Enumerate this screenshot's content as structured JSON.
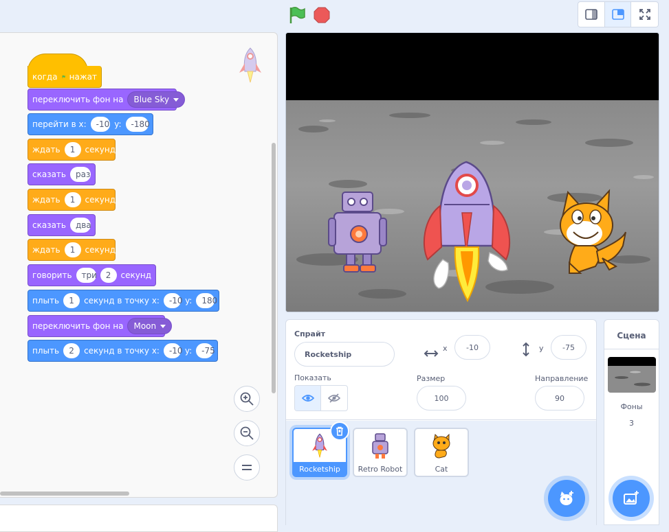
{
  "colors": {
    "events": "#ffbf00",
    "looks": "#9966ff",
    "motion": "#4c97ff",
    "control": "#ffab19",
    "accent": "#4c97ff"
  },
  "toolbar": {
    "green_flag": "green-flag-icon",
    "stop": "stop-icon",
    "layout_small": "small-stage-icon",
    "layout_normal": "normal-stage-icon",
    "fullscreen": "fullscreen-icon"
  },
  "script": {
    "hat": {
      "text1": "когда",
      "text2": "нажат"
    },
    "b1": {
      "text": "переключить фон на",
      "backdrop": "Blue Sky"
    },
    "b2": {
      "text": "перейти в x:",
      "x": "-10",
      "ylabel": "y:",
      "y": "-180"
    },
    "b3": {
      "text": "ждать",
      "secs": "1",
      "unit": "секунд"
    },
    "b4": {
      "text": "сказать",
      "msg": "раз"
    },
    "b5": {
      "text": "ждать",
      "secs": "1",
      "unit": "секунд"
    },
    "b6": {
      "text": "сказать",
      "msg": "два"
    },
    "b7": {
      "text": "ждать",
      "secs": "1",
      "unit": "секунд"
    },
    "b8": {
      "text": "говорить",
      "msg": "три",
      "secs": "2",
      "unit": "секунд"
    },
    "b9": {
      "text": "плыть",
      "secs": "1",
      "mid": "секунд в точку x:",
      "x": "-10",
      "ylabel": "y:",
      "y": "180"
    },
    "b10": {
      "text": "переключить фон на",
      "backdrop": "Moon"
    },
    "b11": {
      "text": "плыть",
      "secs": "2",
      "mid": "секунд в точку x:",
      "x": "-10",
      "ylabel": "y:",
      "y": "-75"
    }
  },
  "sprite_info": {
    "title": "Спрайт",
    "name": "Rocketship",
    "x_label": "x",
    "x": "-10",
    "y_label": "y",
    "y": "-75",
    "show_label": "Показать",
    "size_label": "Размер",
    "size": "100",
    "direction_label": "Направление",
    "direction": "90"
  },
  "sprites": [
    {
      "name": "Rocketship"
    },
    {
      "name": "Retro Robot"
    },
    {
      "name": "Cat"
    }
  ],
  "scene": {
    "title": "Сцена",
    "backdrops_label": "Фоны",
    "backdrops_count": "3"
  }
}
